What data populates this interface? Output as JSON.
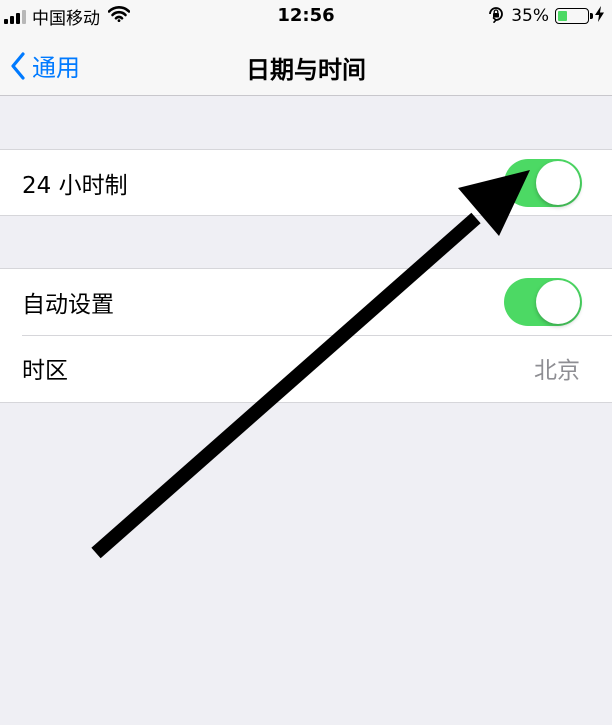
{
  "status_bar": {
    "carrier": "中国移动",
    "time": "12:56",
    "battery_percent": "35%",
    "battery_level": 0.35,
    "battery_color": "#4cd964",
    "icons": [
      "cellular-signal-icon",
      "wifi-icon",
      "orientation-lock-icon",
      "battery-icon",
      "charging-bolt-icon"
    ]
  },
  "nav": {
    "back_label": "通用",
    "title": "日期与时间",
    "accent_color": "#007aff"
  },
  "groups": [
    {
      "rows": [
        {
          "label": "24 小时制",
          "type": "toggle",
          "on": true
        }
      ]
    },
    {
      "rows": [
        {
          "label": "自动设置",
          "type": "toggle",
          "on": true
        },
        {
          "label": "时区",
          "type": "value",
          "value": "北京"
        }
      ]
    }
  ],
  "toggle_on_color": "#4cd964",
  "annotation": {
    "type": "arrow",
    "color": "#000000",
    "points_to": "24 小时制 toggle"
  }
}
